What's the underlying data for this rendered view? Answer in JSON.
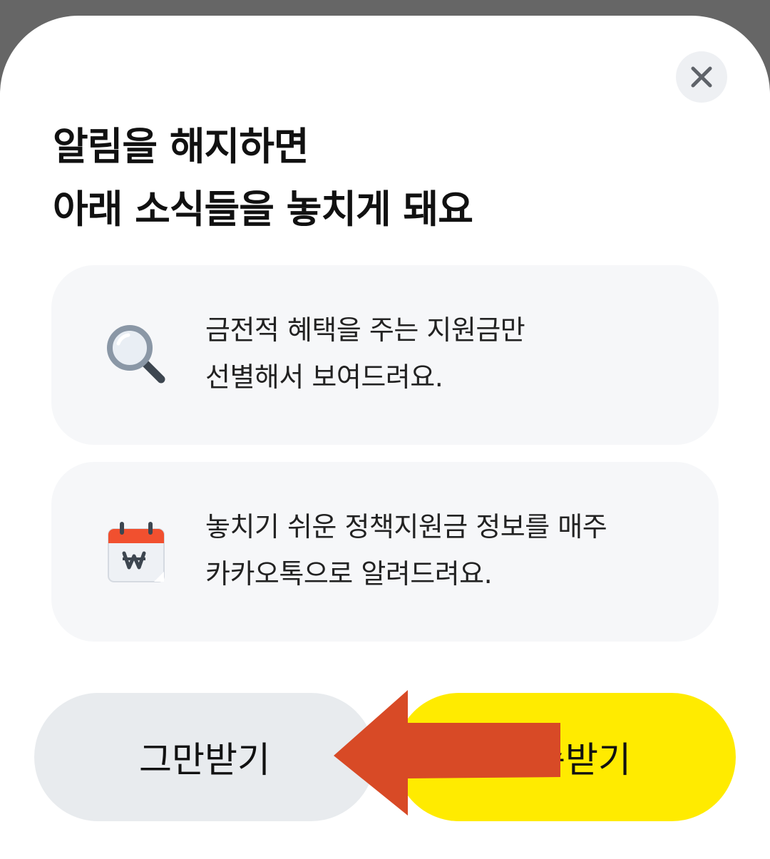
{
  "title": {
    "line1": "알림을 해지하면",
    "line2": "아래 소식들을 놓치게 돼요"
  },
  "cards": [
    {
      "icon": "magnifier-icon",
      "line1": "금전적 혜택을 주는 지원금만",
      "line2": "선별해서 보여드려요."
    },
    {
      "icon": "calendar-won-icon",
      "line1": "놓치기 쉬운 정책지원금 정보를 매주",
      "line2": "카카오톡으로 알려드려요."
    }
  ],
  "buttons": {
    "stop_label": "그만받기",
    "keep_label": "계속받기"
  },
  "colors": {
    "keep_button": "#ffeb00",
    "stop_button": "#e8ebee",
    "card_bg": "#f6f7f9",
    "annotation_arrow": "#d84a26"
  }
}
